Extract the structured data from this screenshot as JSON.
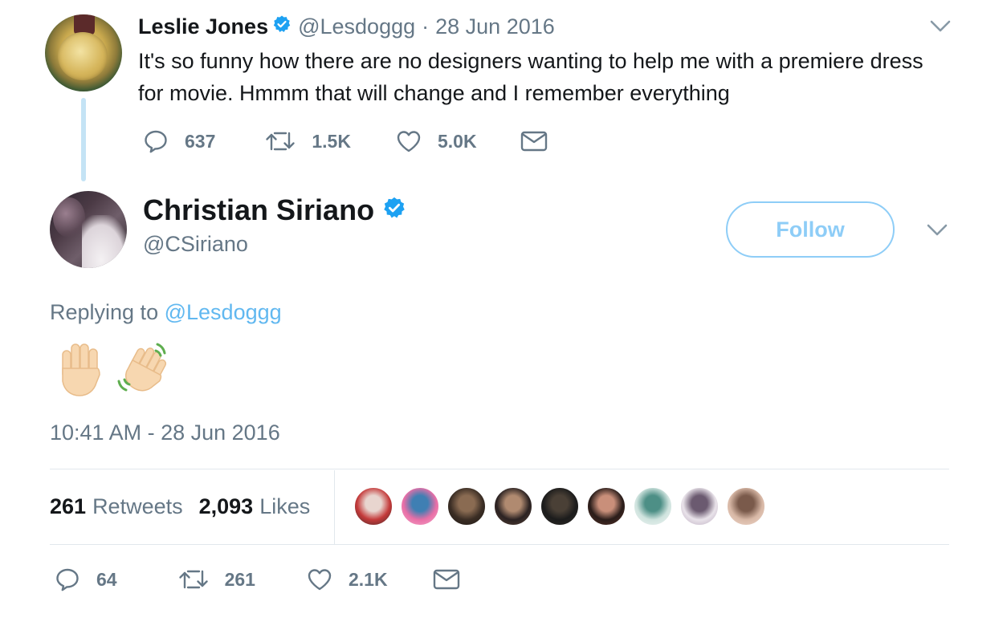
{
  "parent_tweet": {
    "display_name": "Leslie Jones",
    "handle": "@Lesdoggg",
    "separator": "·",
    "date": "28 Jun 2016",
    "text": "It's so funny how there are no designers wanting to help me with a premiere dress for movie. Hmmm that will change and I remember everything",
    "replies": "637",
    "retweets": "1.5K",
    "likes": "5.0K"
  },
  "main_tweet": {
    "display_name": "Christian Siriano",
    "handle": "@CSiriano",
    "follow_label": "Follow",
    "replying_prefix": "Replying to",
    "replying_to": "@Lesdoggg",
    "emoji": [
      "raised-hand-emoji",
      "waving-hand-emoji"
    ],
    "timestamp": "10:41 AM - 28 Jun 2016",
    "retweet_count": "261",
    "retweet_label": "Retweets",
    "like_count": "2,093",
    "like_label": "Likes",
    "replies": "64",
    "retweets": "261",
    "likes": "2.1K"
  },
  "liker_avatars": [
    {
      "name": "liker-avatar-1",
      "colors": [
        "#c43a3a",
        "#e8d5cf",
        "#3a2a2a"
      ]
    },
    {
      "name": "liker-avatar-2",
      "colors": [
        "#e96fa7",
        "#3f7fb3",
        "#f4a9c9"
      ]
    },
    {
      "name": "liker-avatar-3",
      "colors": [
        "#3a2d24",
        "#8a6b52",
        "#1f1915"
      ]
    },
    {
      "name": "liker-avatar-4",
      "colors": [
        "#2b2222",
        "#b08a70",
        "#5a4438"
      ]
    },
    {
      "name": "liker-avatar-5",
      "colors": [
        "#1c1c1c",
        "#4a4036",
        "#2e2a26"
      ]
    },
    {
      "name": "liker-avatar-6",
      "colors": [
        "#2a1d1a",
        "#c98f7a",
        "#5a3228"
      ]
    },
    {
      "name": "liker-avatar-7",
      "colors": [
        "#cfe3de",
        "#4d8f86",
        "#f1f6f4"
      ]
    },
    {
      "name": "liker-avatar-8",
      "colors": [
        "#e9e3ea",
        "#6b5a70",
        "#b9a9bd"
      ]
    },
    {
      "name": "liker-avatar-9",
      "colors": [
        "#d8b8a6",
        "#7a5a4b",
        "#f0d9cc"
      ]
    }
  ],
  "colors": {
    "text_primary": "#14171a",
    "text_secondary": "#657786",
    "brand_blue": "#1da1f2",
    "follow_border": "#8ecdf7",
    "mention": "#61b8f0",
    "divider": "#e1e8ed",
    "thread_line": "#c4e3f5"
  }
}
